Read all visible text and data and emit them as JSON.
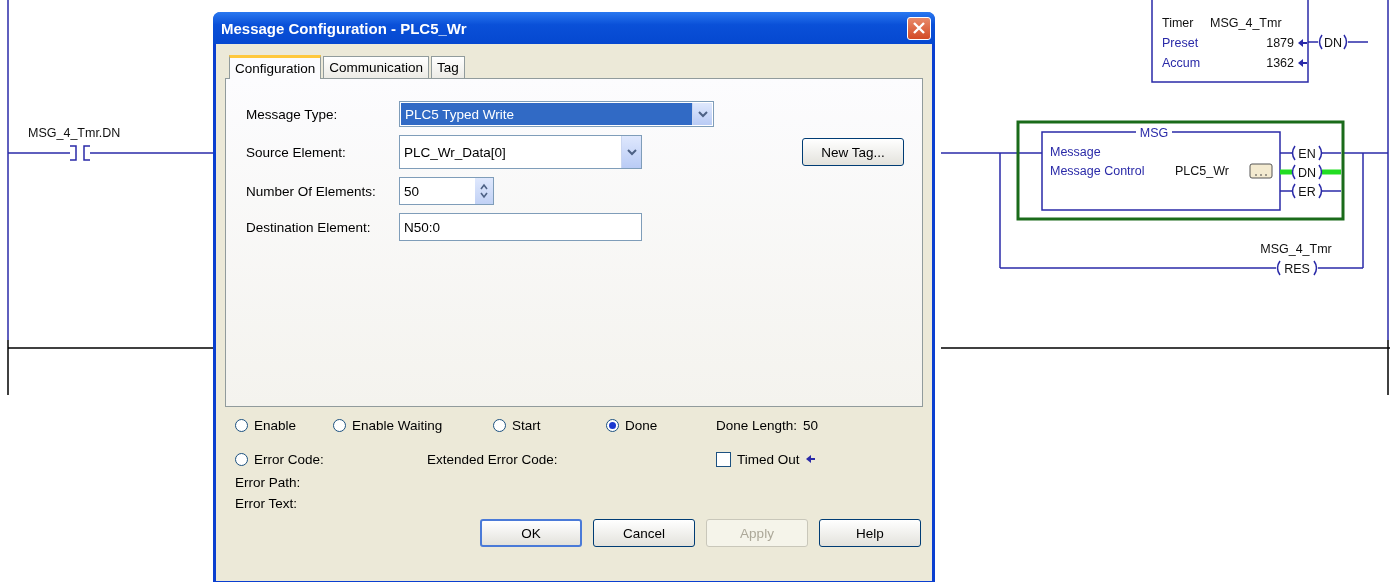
{
  "ladder": {
    "contact": {
      "tag": "MSG_4_Tmr.DN"
    },
    "timer": {
      "rows": [
        {
          "label": "Timer",
          "value": "MSG_4_Tmr"
        },
        {
          "label": "Preset",
          "value": "1879"
        },
        {
          "label": "Accum",
          "value": "1362"
        }
      ],
      "coil": {
        "label": "DN",
        "energized": false
      }
    },
    "msg_block": {
      "title": "MSG",
      "type_label": "Message",
      "control_label": "Message Control",
      "control_value": "PLC5_Wr",
      "coils": [
        {
          "label": "EN",
          "energized": false
        },
        {
          "label": "DN",
          "energized": true
        },
        {
          "label": "ER",
          "energized": false
        }
      ]
    },
    "reset_coil": {
      "tag": "MSG_4_Tmr",
      "label": "RES"
    }
  },
  "dialog": {
    "title": "Message Configuration - PLC5_Wr",
    "tabs": [
      {
        "label": "Configuration",
        "selected": true
      },
      {
        "label": "Communication",
        "selected": false
      },
      {
        "label": "Tag",
        "selected": false
      }
    ],
    "fields": [
      {
        "kind": "dropdown",
        "label": "Message Type:",
        "value": "PLC5 Typed Write"
      },
      {
        "kind": "combo",
        "label": "Source Element:",
        "value": "PLC_Wr_Data[0]"
      },
      {
        "kind": "spinner",
        "label": "Number Of Elements:",
        "value": "50"
      },
      {
        "kind": "text",
        "label": "Destination Element:",
        "value": "N50:0"
      }
    ],
    "new_tag_button": "New Tag...",
    "status_radios": [
      {
        "label": "Enable",
        "selected": false
      },
      {
        "label": "Enable Waiting",
        "selected": false
      },
      {
        "label": "Start",
        "selected": false
      },
      {
        "label": "Done",
        "selected": true
      }
    ],
    "done_length": {
      "label": "Done Length:",
      "value": "50"
    },
    "error_code_radio": {
      "label": "Error Code:",
      "selected": false
    },
    "extended_error_code": "Extended Error Code:",
    "timed_out": {
      "label": "Timed Out",
      "checked": false
    },
    "error_path": "Error Path:",
    "error_text": "Error Text:",
    "buttons": [
      {
        "label": "OK",
        "default": true,
        "disabled": false
      },
      {
        "label": "Cancel",
        "default": false,
        "disabled": false
      },
      {
        "label": "Apply",
        "default": false,
        "disabled": true
      },
      {
        "label": "Help",
        "default": false,
        "disabled": false
      }
    ]
  }
}
